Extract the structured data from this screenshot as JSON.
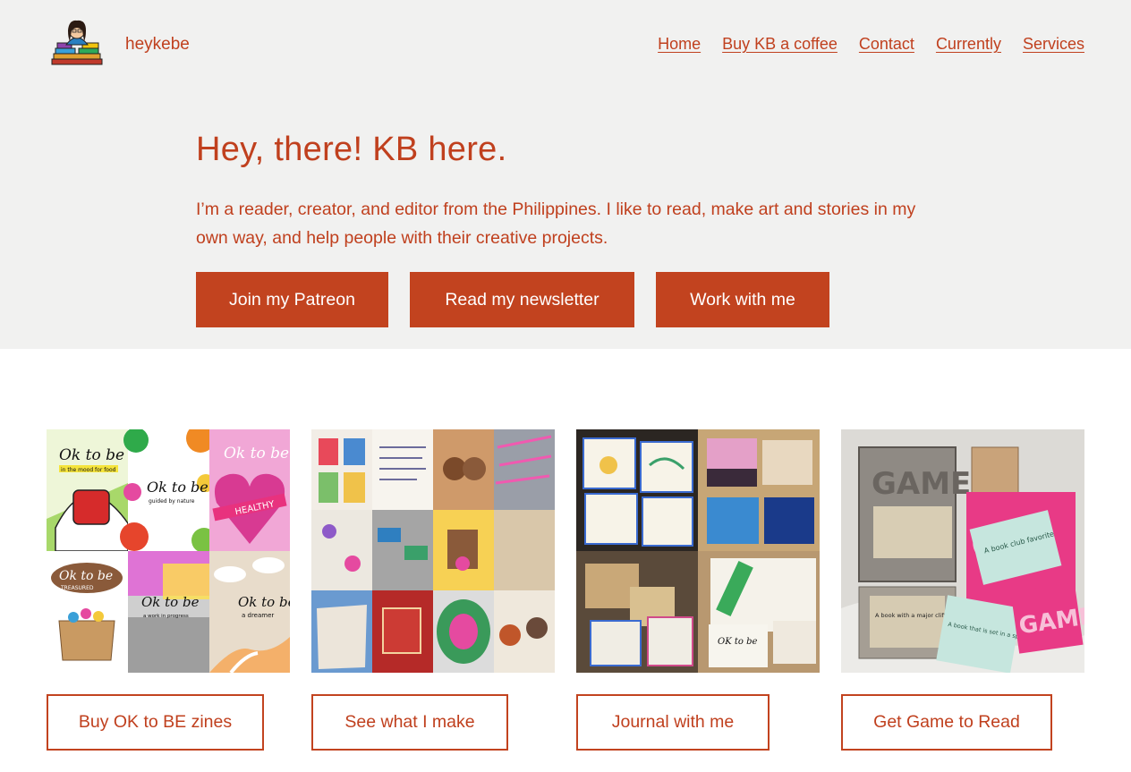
{
  "site": {
    "title": "heykebe"
  },
  "nav": [
    "Home",
    "Buy KB a coffee",
    "Contact",
    "Currently",
    "Services"
  ],
  "hero": {
    "headline": "Hey, there! KB here.",
    "intro": "I’m a reader, creator, and editor from the Philippines. I like to read, make art and stories in my own way, and help people with their creative projects.",
    "buttons": [
      "Join my Patreon",
      "Read my newsletter",
      "Work with me"
    ]
  },
  "cards": [
    {
      "button": "Buy OK to BE zines",
      "tiles": [
        "Ok to be",
        "in the mood for food",
        "Ok to be",
        "guided by nature",
        "Ok to be",
        "HEALTHY",
        "Ok to be",
        "TREASURED",
        "Ok to be",
        "a work in progress",
        "Ok to be",
        "a dreamer"
      ]
    },
    {
      "button": "See what I make"
    },
    {
      "button": "Journal with me"
    },
    {
      "button": "Get Game to Read",
      "texts": [
        "GAME",
        "A book club favorite",
        "A book with a major cliffhanger that you love",
        "A book that is set in a specific location",
        "GAME"
      ]
    }
  ],
  "colors": {
    "accent": "#c2431f",
    "hero_bg": "#f1f1f0",
    "text": "#c0401e"
  }
}
